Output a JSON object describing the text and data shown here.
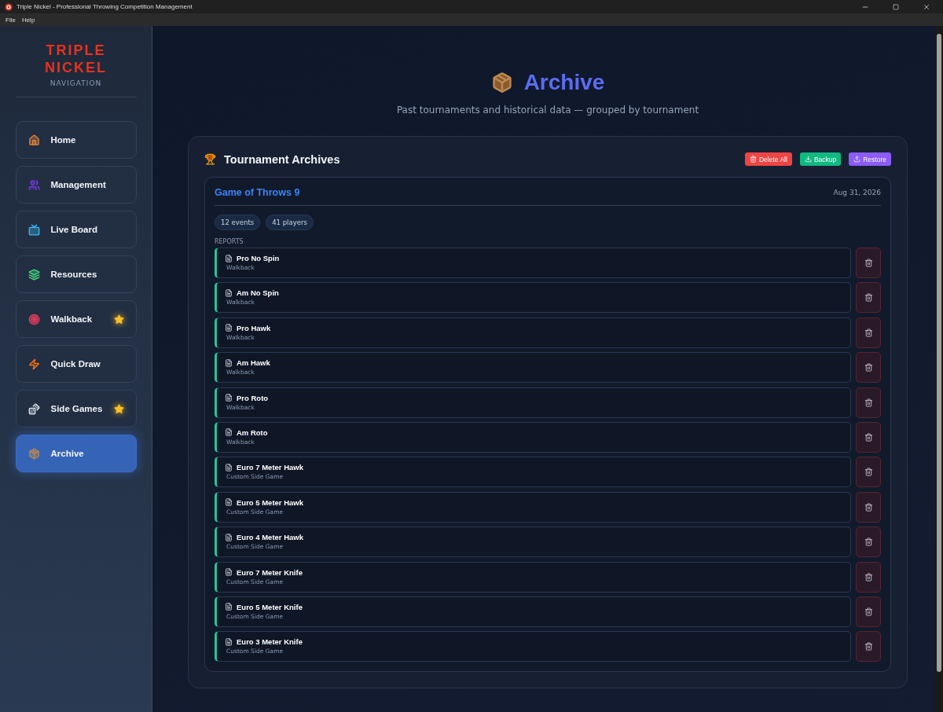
{
  "window": {
    "title": "Triple Nickel - Professional Throwing Competition Management"
  },
  "menu": [
    "File",
    "Help"
  ],
  "sidebar": {
    "logo_lines": [
      "TRIPLE",
      "NICKEL"
    ],
    "subtitle": "NAVIGATION",
    "items": [
      {
        "label": "Home",
        "selected": false,
        "starred": false
      },
      {
        "label": "Management",
        "selected": false,
        "starred": false
      },
      {
        "label": "Live Board",
        "selected": false,
        "starred": false
      },
      {
        "label": "Resources",
        "selected": false,
        "starred": false
      },
      {
        "label": "Walkback",
        "selected": false,
        "starred": true
      },
      {
        "label": "Quick Draw",
        "selected": false,
        "starred": false
      },
      {
        "label": "Side Games",
        "selected": false,
        "starred": true
      },
      {
        "label": "Archive",
        "selected": true,
        "starred": false
      }
    ]
  },
  "header": {
    "title": "Archive",
    "subtitle": "Past tournaments and historical data — grouped by tournament"
  },
  "panel": {
    "title": "Tournament Archives",
    "buttons": [
      {
        "label": "Delete All",
        "kind": "danger"
      },
      {
        "label": "Backup",
        "kind": "backup"
      },
      {
        "label": "Restore",
        "kind": "restore"
      }
    ],
    "tournament": {
      "name": "Game of Throws 9",
      "date": "Aug 31, 2026",
      "badges": [
        "12 events",
        "41 players"
      ],
      "section_label": "REPORTS",
      "reports": [
        {
          "name": "Pro No Spin",
          "type": "Walkback"
        },
        {
          "name": "Am No Spin",
          "type": "Walkback"
        },
        {
          "name": "Pro Hawk",
          "type": "Walkback"
        },
        {
          "name": "Am Hawk",
          "type": "Walkback"
        },
        {
          "name": "Pro Roto",
          "type": "Walkback"
        },
        {
          "name": "Am Roto",
          "type": "Walkback"
        },
        {
          "name": "Euro 7 Meter Hawk",
          "type": "Custom Side Game"
        },
        {
          "name": "Euro 5 Meter Hawk",
          "type": "Custom Side Game"
        },
        {
          "name": "Euro 4 Meter Hawk",
          "type": "Custom Side Game"
        },
        {
          "name": "Euro 7 Meter Knife",
          "type": "Custom Side Game"
        },
        {
          "name": "Euro 5 Meter Knife",
          "type": "Custom Side Game"
        },
        {
          "name": "Euro 3 Meter Knife",
          "type": "Custom Side Game"
        }
      ]
    }
  }
}
